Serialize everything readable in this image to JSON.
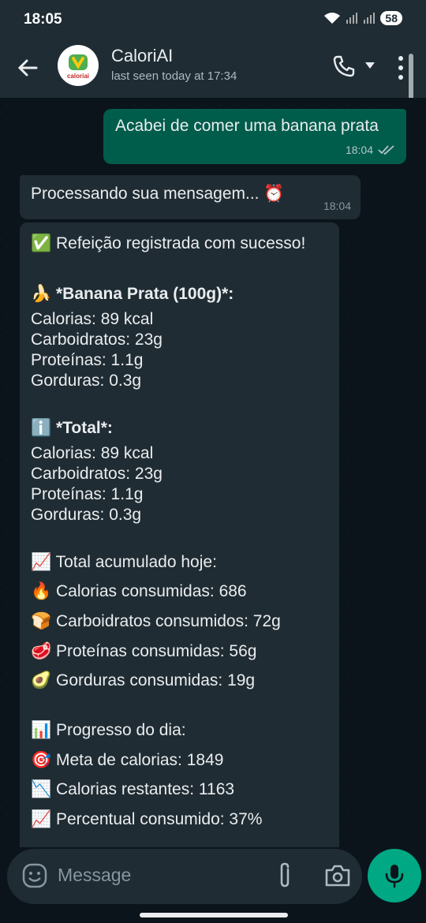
{
  "status": {
    "time": "18:05",
    "battery": "58"
  },
  "header": {
    "name": "CaloriAI",
    "last_seen": "last seen today at 17:34",
    "logo_text": "caloriai"
  },
  "messages": {
    "outgoing": {
      "text": "Acabei de comer uma banana prata",
      "time": "18:04"
    },
    "incoming1": {
      "text": "Processando sua mensagem... ⏰",
      "time": "18:04"
    },
    "incoming2": {
      "lines": [
        "✅ Refeição registrada com sucesso!",
        "🍌 *Banana Prata (100g)*:",
        "Calorias: 89 kcal",
        "Carboidratos: 23g",
        "Proteínas: 1.1g",
        "Gorduras: 0.3g",
        "ℹ️ *Total*:",
        "Calorias: 89 kcal",
        "Carboidratos: 23g",
        "Proteínas: 1.1g",
        "Gorduras: 0.3g",
        "📈 Total acumulado hoje:",
        "🔥 Calorias consumidas: 686",
        "🍞 Carboidratos consumidos: 72g",
        "🥩 Proteínas consumidas: 56g",
        "🥑 Gorduras consumidas: 19g",
        "📊 Progresso do dia:",
        "🎯 Meta de calorias: 1849",
        "📉 Calorias restantes: 1163",
        "📈 Percentual consumido: 37%"
      ]
    }
  },
  "input": {
    "placeholder": "Message"
  }
}
